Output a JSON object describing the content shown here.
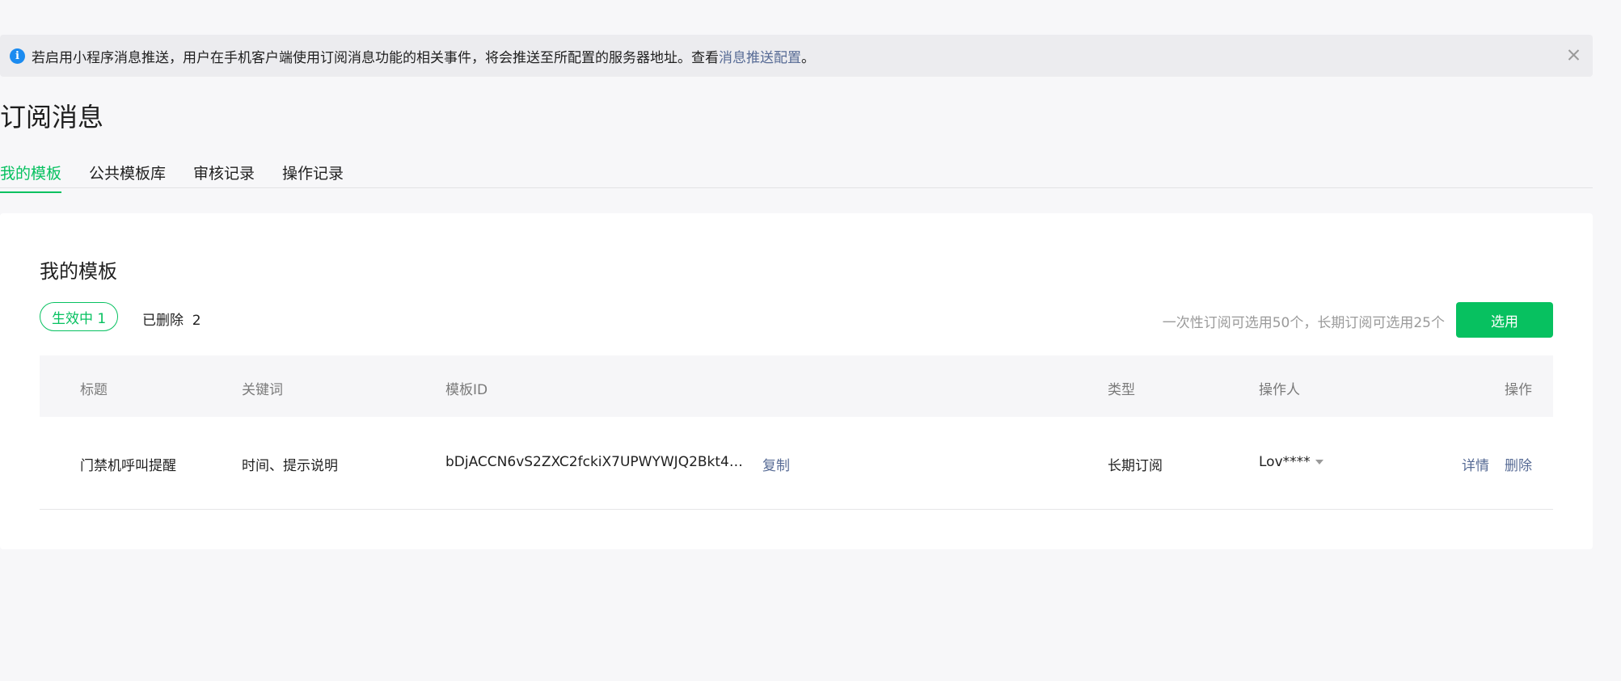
{
  "notice": {
    "text": "若启用小程序消息推送，用户在手机客户端使用订阅消息功能的相关事件，将会推送至所配置的服务器地址。查看 ",
    "link": "消息推送配置",
    "suffix": "。"
  },
  "page": {
    "title": "订阅消息"
  },
  "tabs": [
    {
      "label": "我的模板",
      "active": true
    },
    {
      "label": "公共模板库",
      "active": false
    },
    {
      "label": "审核记录",
      "active": false
    },
    {
      "label": "操作记录",
      "active": false
    }
  ],
  "card": {
    "title": "我的模板",
    "filter_active": "生效中 1",
    "filter_deleted": "已删除  2",
    "quota_text": "一次性订阅可选用50个，长期订阅可选用25个",
    "select_button": "选用"
  },
  "table": {
    "headers": [
      "标题",
      "关键词",
      "模板ID",
      "类型",
      "操作人",
      "操作"
    ],
    "rows": [
      {
        "title": "门禁机呼叫提醒",
        "keywords": "时间、提示说明",
        "template_id": "bDjACCN6vS2ZXC2fckiX7UPWYWJQ2Bkt4Y...",
        "copy": "复制",
        "type": "长期订阅",
        "operator": "Lov****",
        "detail": "详情",
        "delete": "删除"
      }
    ]
  },
  "colors": {
    "accent": "#07c160",
    "link": "#576b95",
    "info": "#1b8bf0"
  }
}
